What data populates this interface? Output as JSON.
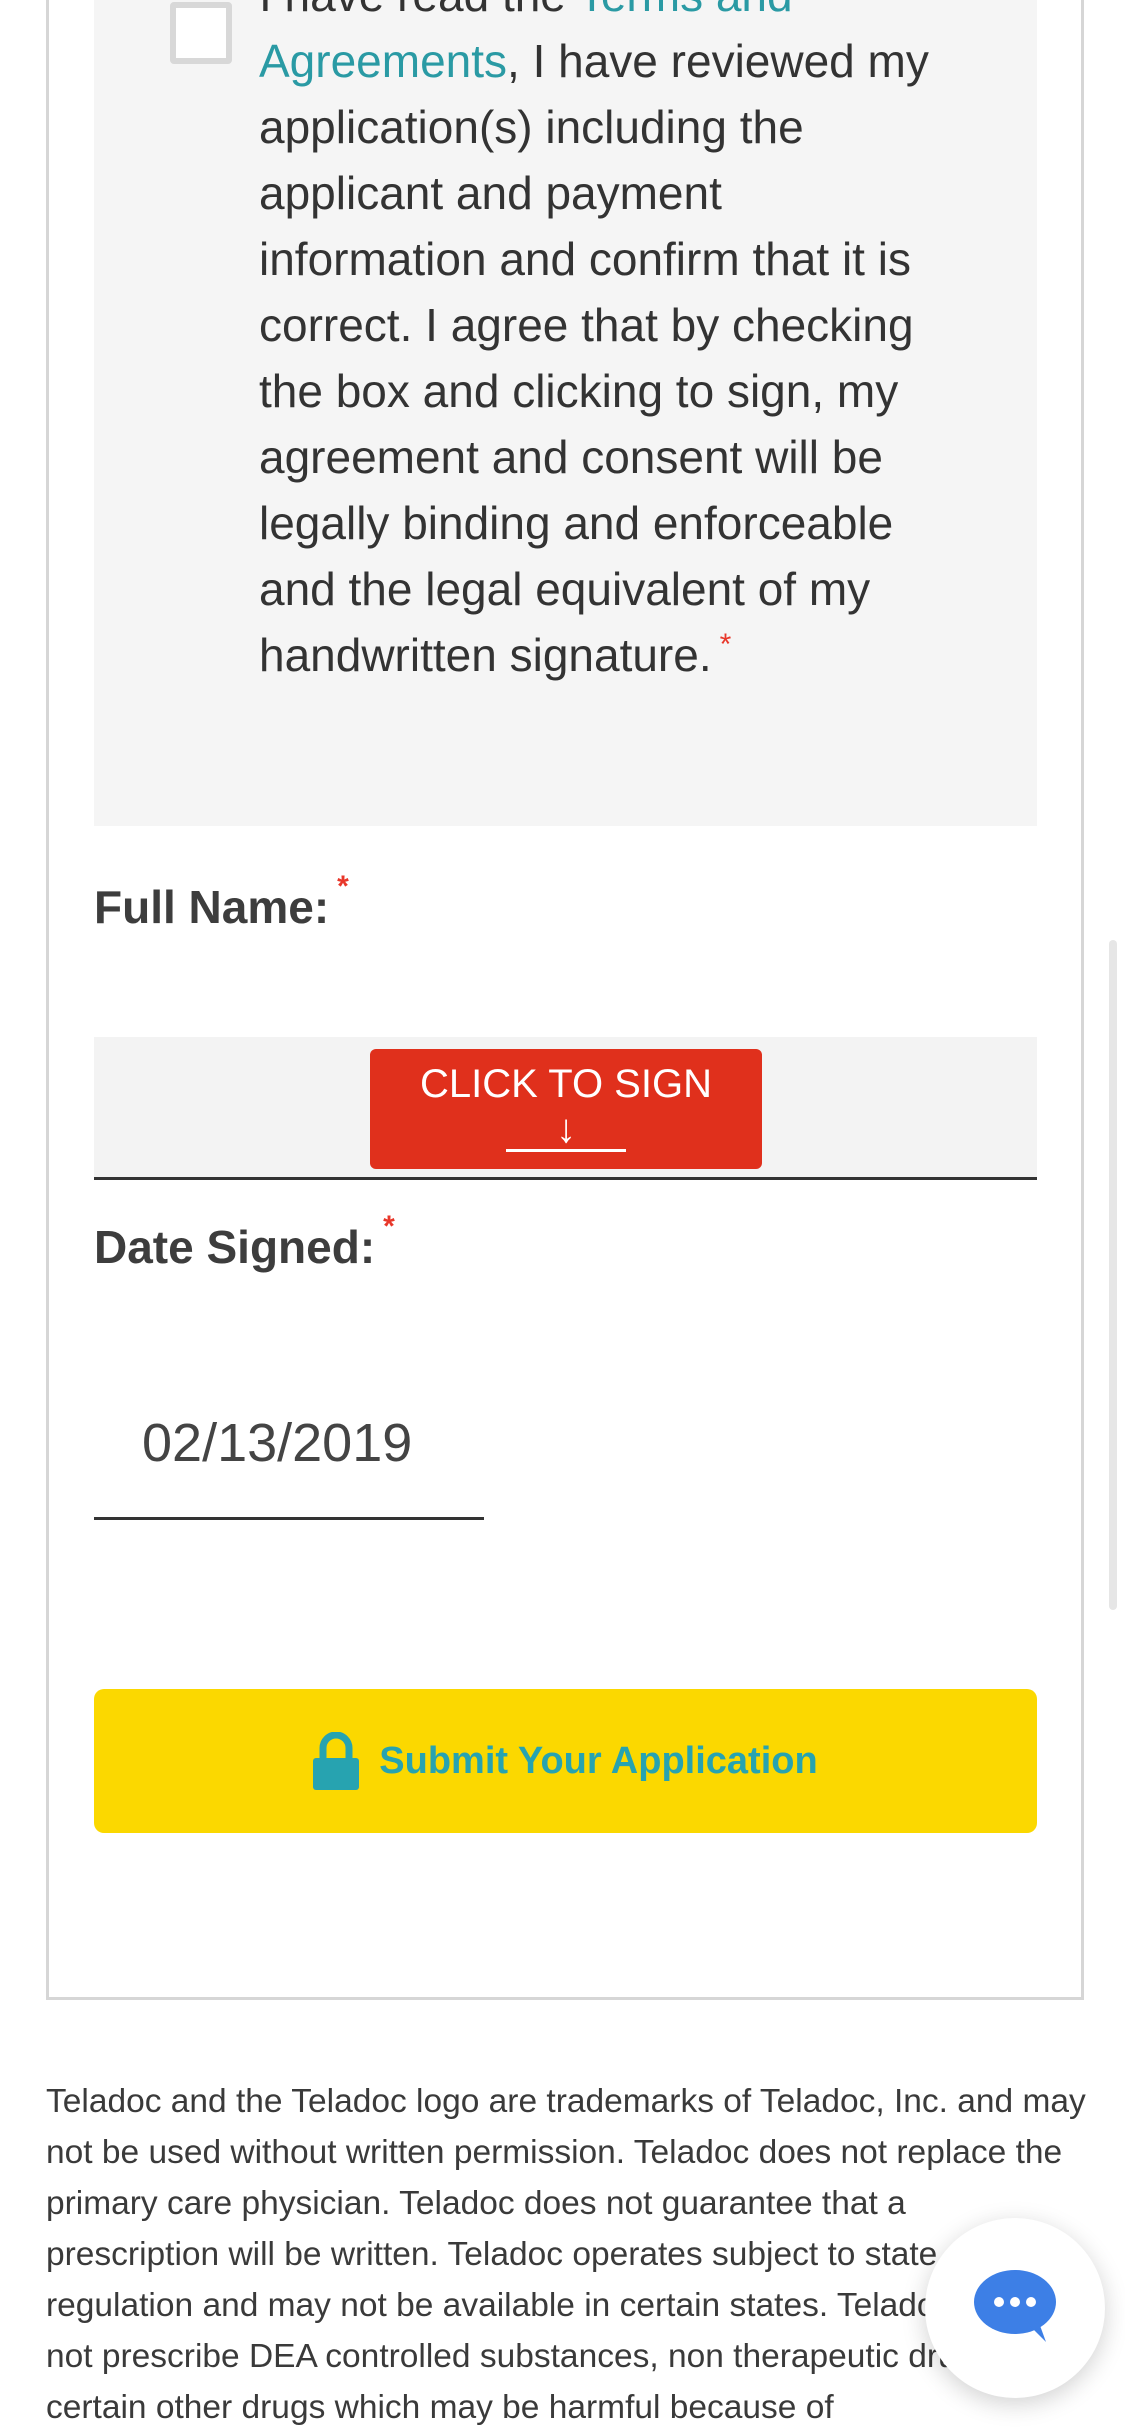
{
  "agreement": {
    "prefix": "I have read the ",
    "link": "Terms and Agreements",
    "body": ", I have reviewed my application(s) including the applicant and payment information and confirm that it is correct. I agree that by checking the box and clicking to sign, my agreement and consent will be legally binding and enforceable and the legal equivalent of my handwritten signature.",
    "required_mark": "*",
    "checked": false
  },
  "full_name": {
    "label": "Full Name:",
    "required_mark": "*",
    "sign_button": "CLICK TO SIGN",
    "sign_arrow": "↓"
  },
  "date_signed": {
    "label": "Date Signed:",
    "required_mark": "*",
    "value": "02/13/2019"
  },
  "submit": {
    "label": "Submit Your Application",
    "icon": "lock-icon"
  },
  "footer": {
    "text": "Teladoc and the Teladoc logo are trademarks of Teladoc, Inc. and may not be used without written permission. Teladoc does not replace the primary care physician. Teladoc does not guarantee that a prescription will be written. Teladoc operates subject to state regulation and may not be available in certain states. Teladoc does not prescribe DEA controlled substances, non therapeutic drugs and certain other drugs which may be harmful because of"
  },
  "chat": {
    "icon": "chat-bubble-icon"
  },
  "colors": {
    "accent": "#2a9aa4",
    "sign_button": "#e0301c",
    "submit_button": "#fbd800",
    "required": "#e8372a",
    "chat": "#3d7fe6"
  }
}
